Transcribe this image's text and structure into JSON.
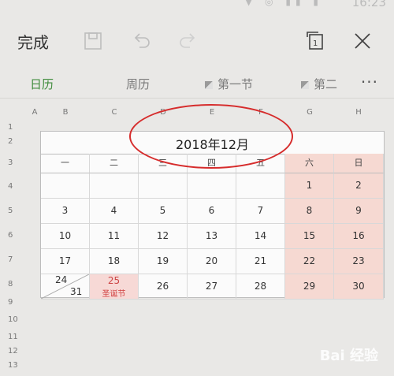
{
  "status": {
    "time": "16:23",
    "icons": "▼ ◎ ▮▮ ▮"
  },
  "toolbar": {
    "done_label": "完成"
  },
  "tabs": [
    {
      "label": "日历",
      "active": true
    },
    {
      "label": "周历",
      "active": false
    },
    {
      "label": "第一节",
      "active": false
    },
    {
      "label": "第二",
      "active": false
    }
  ],
  "more_label": "···",
  "columns": [
    "A",
    "B",
    "C",
    "D",
    "E",
    "F",
    "G",
    "H"
  ],
  "rows": [
    "1",
    "2",
    "3",
    "4",
    "5",
    "6",
    "7",
    "8",
    "9",
    "10",
    "11",
    "12",
    "13"
  ],
  "calendar": {
    "title": "2018年12月",
    "weekdays": [
      "一",
      "二",
      "三",
      "四",
      "五",
      "六",
      "日"
    ],
    "weeks": [
      [
        "",
        "",
        "",
        "",
        "",
        "1",
        "2"
      ],
      [
        "3",
        "4",
        "5",
        "6",
        "7",
        "8",
        "9"
      ],
      [
        "10",
        "11",
        "12",
        "13",
        "14",
        "15",
        "16"
      ],
      [
        "17",
        "18",
        "19",
        "20",
        "21",
        "22",
        "23"
      ],
      [
        "24",
        "25",
        "26",
        "27",
        "28",
        "29",
        "30"
      ]
    ],
    "split_cell": {
      "top": "24",
      "bottom": "31"
    },
    "holiday": {
      "day": "25",
      "name": "圣诞节"
    }
  },
  "colors": {
    "accent": "#3f8b3c",
    "weekend": "#f6d9d2",
    "annotation": "#d62c2c"
  },
  "watermark": "Bai 经验"
}
